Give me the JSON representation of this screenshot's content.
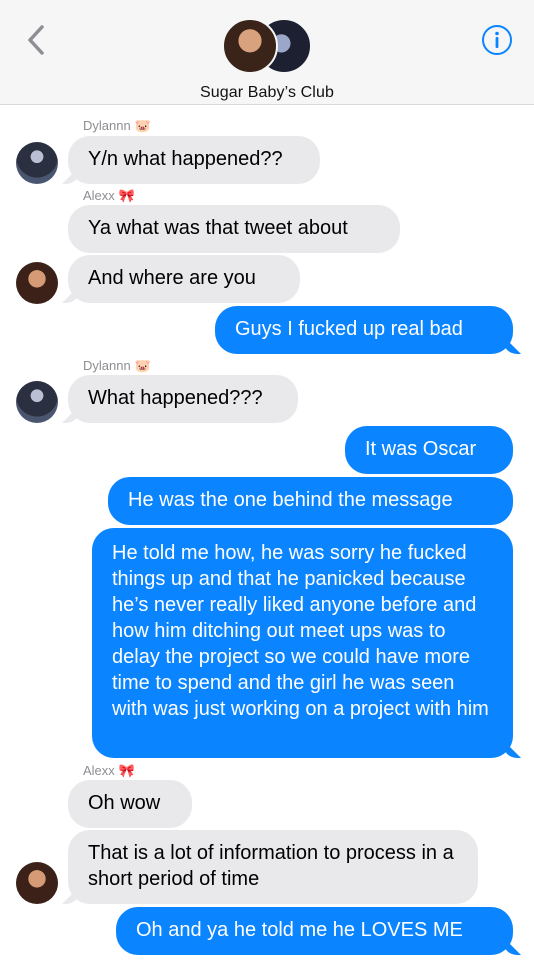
{
  "header": {
    "group_name": "Sugar Baby’s Club"
  },
  "senders": {
    "dylan": "Dylannn",
    "dylan_emoji": "🐷",
    "alex": "Alexx",
    "alex_emoji": "🎀"
  },
  "messages": {
    "m1": "Y/n what happened??",
    "m2": "Ya what was that tweet about",
    "m3": "And where are you",
    "m4": "Guys I fucked up real bad",
    "m5": "What happened???",
    "m6": "It was Oscar",
    "m7": "He was the one behind the message",
    "m8": "He told me how, he was sorry he fucked things up and that he panicked because he’s never really liked anyone before and how him ditching out meet ups was to delay the project so we could have more time to spend and the girl he was seen with was just working on a project with him",
    "m9": "Oh wow",
    "m10": "That is a lot of information to process in a short period of time",
    "m11": "Oh and ya he told me he LOVES ME"
  },
  "colors": {
    "outgoing": "#0a84ff",
    "incoming": "#e9e9eb",
    "accent": "#0a84ff"
  },
  "icons": {
    "back": "chevron-left-icon",
    "info": "info-icon"
  }
}
